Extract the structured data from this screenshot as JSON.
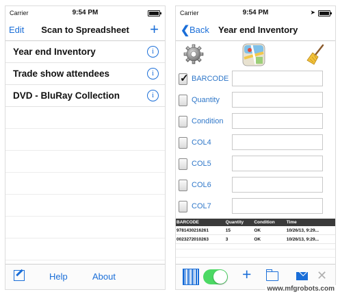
{
  "left": {
    "status": {
      "carrier": "Carrier",
      "time": "9:54 PM"
    },
    "nav": {
      "edit": "Edit",
      "title": "Scan to Spreadsheet",
      "add": "+"
    },
    "items": [
      {
        "label": "Year end Inventory"
      },
      {
        "label": "Trade show attendees"
      },
      {
        "label": "DVD - BluRay Collection"
      }
    ],
    "info_glyph": "i",
    "toolbar": {
      "compose_icon": "compose-icon",
      "help": "Help",
      "about": "About"
    }
  },
  "right": {
    "status": {
      "carrier": "Carrier",
      "time": "9:54 PM",
      "location_glyph": "➤"
    },
    "nav": {
      "back_chevron": "❮",
      "back": "Back",
      "title": "Year end Inventory"
    },
    "icons": [
      "gear-icon",
      "map-icon",
      "broom-icon"
    ],
    "fields": [
      {
        "label": "BARCODE",
        "checked": true
      },
      {
        "label": "Quantity",
        "checked": false
      },
      {
        "label": "Condition",
        "checked": false
      },
      {
        "label": "COL4",
        "checked": false
      },
      {
        "label": "COL5",
        "checked": false
      },
      {
        "label": "COL6",
        "checked": false
      },
      {
        "label": "COL7",
        "checked": false
      }
    ],
    "table": {
      "headers": [
        "BARCODE",
        "Quantity",
        "Condition",
        "Time"
      ],
      "rows": [
        [
          "9781430216261",
          "15",
          "OK",
          "10/26/13, 9:29..."
        ],
        [
          "0023272010263",
          "3",
          "OK",
          "10/26/13, 9:29..."
        ]
      ]
    },
    "toolbar": {
      "scan_toggle_on": true,
      "plus": "+",
      "close": "✕"
    }
  },
  "watermark": "www.mfgrobots.com",
  "colors": {
    "accent": "#1a6ed8",
    "toggle_on": "#4cd964",
    "table_header": "#3a3a3a"
  }
}
